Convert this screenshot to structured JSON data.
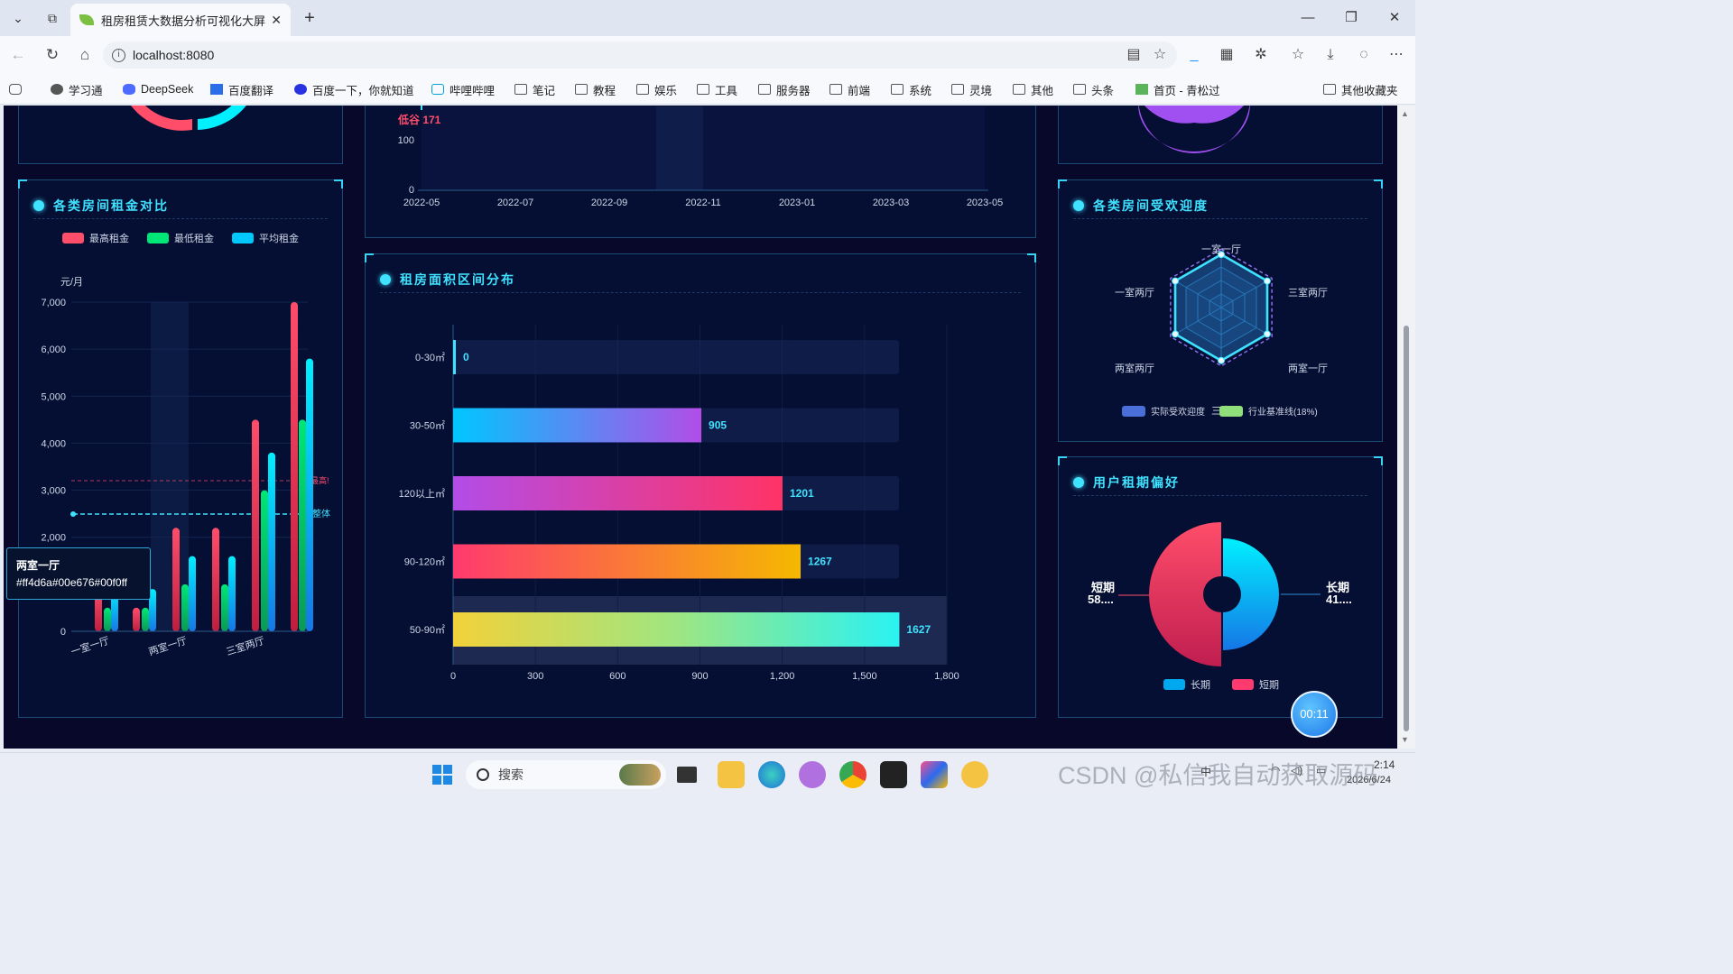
{
  "browser": {
    "tab_title": "租房租赁大数据分析可视化大屏",
    "url": "localhost:8080",
    "bookmarks": [
      "学习通",
      "DeepSeek",
      "百度翻译",
      "百度一下，你就知道",
      "哔哩哔哩",
      "笔记",
      "教程",
      "娱乐",
      "工具",
      "服务器",
      "前端",
      "系统",
      "灵境",
      "其他",
      "头条",
      "首页 - 青松过"
    ],
    "other_bookmarks": "其他收藏夹"
  },
  "top_chart": {
    "annotation": "低谷 171",
    "y_ticks": [
      "100",
      "0"
    ],
    "x_ticks": [
      "2022-05",
      "2022-07",
      "2022-09",
      "2022-11",
      "2023-01",
      "2023-03",
      "2023-05"
    ]
  },
  "rent_panel": {
    "title": "各类房间租金对比",
    "legend": [
      "最高租金",
      "最低租金",
      "平均租金"
    ],
    "unit": "元/月",
    "y_ticks": [
      "7,000",
      "6,000",
      "5,000",
      "4,000",
      "3,000",
      "2,000",
      "0"
    ],
    "x_ticks": [
      "一室一厅",
      "两室一厅",
      "三室两厅"
    ],
    "markline_max": "最高!",
    "markline_avg": "整体",
    "tooltip_title": "两室一厅",
    "tooltip_body": "#ff4d6a#00e676#00f0ff"
  },
  "area_panel": {
    "title": "租房面积区间分布",
    "x_ticks": [
      "0",
      "300",
      "600",
      "900",
      "1,200",
      "1,500",
      "1,800"
    ]
  },
  "popularity_panel": {
    "title": "各类房间受欢迎度",
    "indicators": [
      "一室一厅",
      "三室两厅",
      "两室一厅",
      "三室",
      "两室两厅",
      "一室两厅"
    ],
    "legend": [
      "实际受欢迎度",
      "行业基准线(18%)"
    ]
  },
  "lease_panel": {
    "title": "用户租期偏好",
    "label_short": "短期",
    "value_short": "58....",
    "label_long": "长期",
    "value_long": "41....",
    "legend": [
      "长期",
      "短期"
    ]
  },
  "timer": "00:11",
  "taskbar": {
    "search_placeholder": "搜索",
    "tray_lang": "中",
    "clock_time": "2:14",
    "clock_date": "2026/6/24"
  },
  "watermark": "CSDN @私信我自动获取源码",
  "colors": {
    "accent": "#3fe3ff",
    "bg": "#07082a",
    "max_rent": "#ff4d6a",
    "min_rent": "#00e676",
    "avg_rent": "#00f0ff"
  },
  "chart_data": [
    {
      "type": "bar",
      "title": "各类房间租金对比",
      "categories": [
        "一室一厅",
        "两室一厅",
        "三室两厅"
      ],
      "ylabel": "元/月",
      "ylim": [
        0,
        7000
      ],
      "series": [
        {
          "name": "最高租金",
          "values": [
            2200,
            2200,
            4500,
            7000
          ]
        },
        {
          "name": "最低租金",
          "values": [
            500,
            1000,
            1000,
            3000,
            4500
          ]
        },
        {
          "name": "平均租金",
          "values": [
            1500,
            1600,
            1600,
            3800,
            5800
          ]
        }
      ],
      "marklines": {
        "最高": 3200,
        "整体": 2500
      }
    },
    {
      "type": "bar",
      "title": "租房面积区间分布",
      "orientation": "horizontal",
      "categories": [
        "0-30㎡",
        "30-50㎡",
        "120以上㎡",
        "90-120㎡",
        "50-90㎡"
      ],
      "values": [
        0,
        905,
        1201,
        1267,
        1627
      ],
      "xlim": [
        0,
        1800
      ]
    },
    {
      "type": "pie",
      "title": "用户租期偏好",
      "categories": [
        "短期",
        "长期"
      ],
      "values": [
        58,
        41
      ]
    }
  ]
}
